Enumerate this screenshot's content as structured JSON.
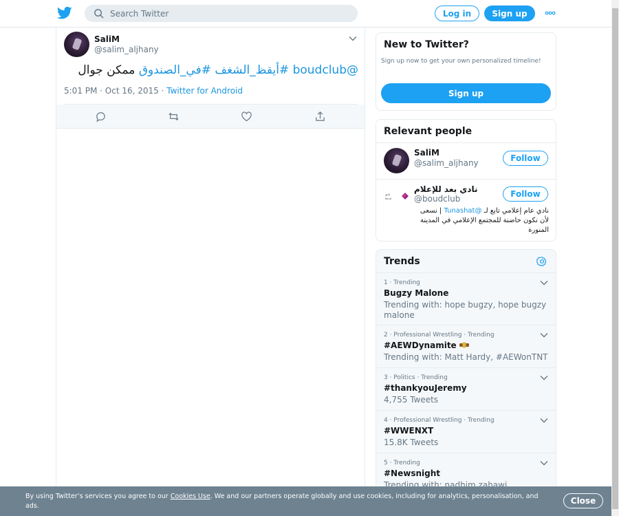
{
  "header": {
    "search_placeholder": "Search Twitter",
    "login_label": "Log in",
    "signup_label": "Sign up",
    "more_icon": "ellipsis-icon",
    "brand_color": "#1da1f2"
  },
  "tweet": {
    "author_name": "SaliM",
    "author_handle": "@salim_aljhany",
    "text_mention": "@boudclub",
    "text_hashtag1": "#أيقظ_الشغف",
    "text_hashtag2": "#في_الصندوق",
    "text_tail": "ممكن جوال",
    "time": "5:01 PM · Oct 16, 2015 · ",
    "source": "Twitter for Android"
  },
  "sidebar": {
    "new_to_twitter": {
      "title": "New to Twitter?",
      "description": "Sign up now to get your own personalized timeline!",
      "signup_label": "Sign up"
    },
    "relevant_people": {
      "title": "Relevant people",
      "people": [
        {
          "name": "SaliM",
          "handle": "@salim_aljhany",
          "follow_label": "Follow"
        },
        {
          "name": "نادي بعد للإعلام",
          "handle": "@boudclub",
          "follow_label": "Follow",
          "bio_pre": "نادي عام إعلامي تابع لـ ",
          "bio_link": "@Tunashat",
          "bio_post": " | نسعى لأن نكون حاضنة للمجتمع الإعلامي في المدينة المنورة"
        }
      ]
    },
    "trends": {
      "title": "Trends",
      "items": [
        {
          "meta": "1 · Trending",
          "name": "Bugzy Malone",
          "sub": "Trending with: hope bugzy, hope bugzy malone"
        },
        {
          "meta": "2 · Professional Wrestling · Trending",
          "name": "#AEWDynamite",
          "sub": "Trending with: Matt Hardy, #AEWonTNT"
        },
        {
          "meta": "3 · Politics · Trending",
          "name": "#thankyouJeremy",
          "sub": "4,755 Tweets"
        },
        {
          "meta": "4 · Professional Wrestling · Trending",
          "name": "#WWENXT",
          "sub": "15.8K Tweets"
        },
        {
          "meta": "5 · Trending",
          "name": "#Newsnight",
          "sub": "Trending with: nadhim zahawi"
        }
      ]
    }
  },
  "cookie_banner": {
    "text_pre": "By using Twitter’s services you agree to our ",
    "link": "Cookies Use",
    "text_post": ". We and our partners operate globally and use cookies, including for analytics, personalisation, and ads.",
    "close_label": "Close"
  }
}
